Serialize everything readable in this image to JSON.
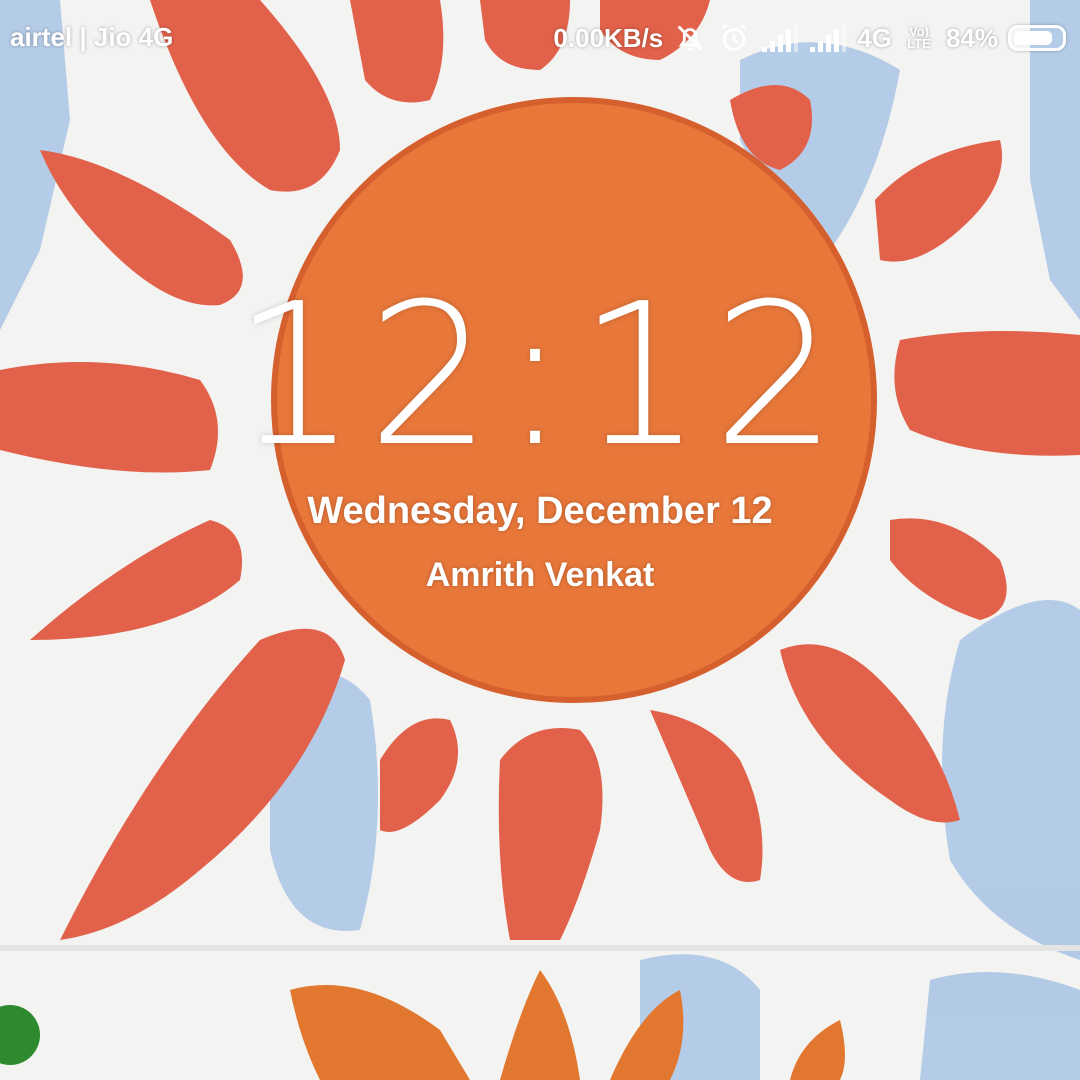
{
  "status_bar": {
    "carrier": "airtel | Jio 4G",
    "net_speed": "0.00KB/s",
    "network_type": "4G",
    "volte_line1": "Vo)",
    "volte_line2": "LTE",
    "battery_percent": "84%",
    "battery_level": 0.84,
    "icons": [
      "bell-off-icon",
      "alarm-icon",
      "signal-icon",
      "signal-icon",
      "volte-icon",
      "battery-icon"
    ]
  },
  "lockscreen": {
    "time": "12:12",
    "date": "Wednesday, December 12",
    "owner_info": "Amrith Venkat"
  },
  "wallpaper": {
    "description_colors": {
      "sun": "#e8773a",
      "rays": "#e2614a",
      "sky": "#a9c4e6",
      "paper": "#f4f4f2"
    }
  }
}
